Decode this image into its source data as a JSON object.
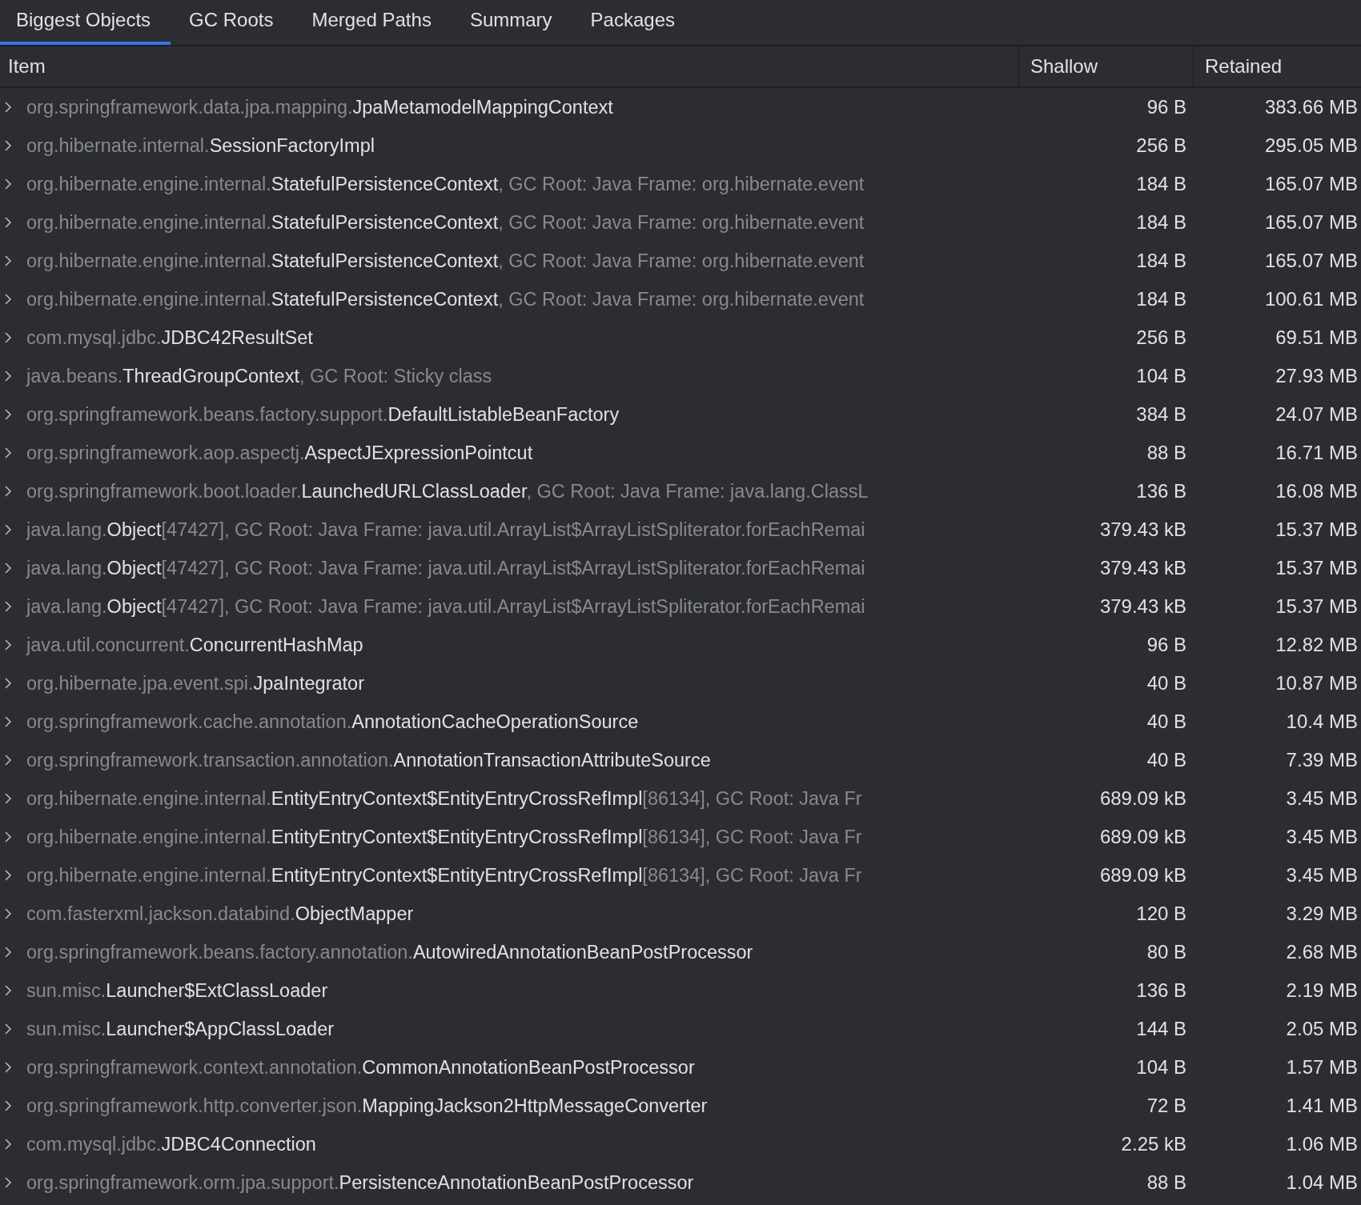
{
  "tabs": [
    {
      "label": "Biggest Objects",
      "selected": true
    },
    {
      "label": "GC Roots",
      "selected": false
    },
    {
      "label": "Merged Paths",
      "selected": false
    },
    {
      "label": "Summary",
      "selected": false
    },
    {
      "label": "Packages",
      "selected": false
    }
  ],
  "table": {
    "columns": [
      "Item",
      "Shallow",
      "Retained"
    ],
    "rows": [
      {
        "expanded": false,
        "package": "org.springframework.data.jpa.mapping.",
        "class": "JpaMetamodelMappingContext",
        "shallow": "96 B",
        "retained": "383.66 MB"
      },
      {
        "expanded": false,
        "package": "org.hibernate.internal.",
        "class": "SessionFactoryImpl",
        "shallow": "256 B",
        "retained": "295.05 MB"
      },
      {
        "expanded": false,
        "package": "org.hibernate.engine.internal.",
        "class": "StatefulPersistenceContext",
        "suffix": ", GC Root: Java Frame: org.hibernate.event",
        "shallow": "184 B",
        "retained": "165.07 MB"
      },
      {
        "expanded": false,
        "package": "org.hibernate.engine.internal.",
        "class": "StatefulPersistenceContext",
        "suffix": ", GC Root: Java Frame: org.hibernate.event",
        "shallow": "184 B",
        "retained": "165.07 MB"
      },
      {
        "expanded": false,
        "package": "org.hibernate.engine.internal.",
        "class": "StatefulPersistenceContext",
        "suffix": ", GC Root: Java Frame: org.hibernate.event",
        "shallow": "184 B",
        "retained": "165.07 MB"
      },
      {
        "expanded": false,
        "package": "org.hibernate.engine.internal.",
        "class": "StatefulPersistenceContext",
        "suffix": ", GC Root: Java Frame: org.hibernate.event",
        "shallow": "184 B",
        "retained": "100.61 MB"
      },
      {
        "expanded": false,
        "package": "com.mysql.jdbc.",
        "class": "JDBC42ResultSet",
        "shallow": "256 B",
        "retained": "69.51 MB"
      },
      {
        "expanded": false,
        "package": "java.beans.",
        "class": "ThreadGroupContext",
        "suffix": ", GC Root: Sticky class",
        "shallow": "104 B",
        "retained": "27.93 MB"
      },
      {
        "expanded": false,
        "package": "org.springframework.beans.factory.support.",
        "class": "DefaultListableBeanFactory",
        "shallow": "384 B",
        "retained": "24.07 MB"
      },
      {
        "expanded": false,
        "package": "org.springframework.aop.aspectj.",
        "class": "AspectJExpressionPointcut",
        "shallow": "88 B",
        "retained": "16.71 MB"
      },
      {
        "expanded": false,
        "package": "org.springframework.boot.loader.",
        "class": "LaunchedURLClassLoader",
        "suffix": ", GC Root: Java Frame: java.lang.ClassL",
        "shallow": "136 B",
        "retained": "16.08 MB"
      },
      {
        "expanded": false,
        "package": "java.lang.",
        "class": "Object",
        "suffix": "[47427], GC Root: Java Frame: java.util.ArrayList$ArrayListSpliterator.forEachRemai",
        "shallow": "379.43 kB",
        "retained": "15.37 MB"
      },
      {
        "expanded": false,
        "package": "java.lang.",
        "class": "Object",
        "suffix": "[47427], GC Root: Java Frame: java.util.ArrayList$ArrayListSpliterator.forEachRemai",
        "shallow": "379.43 kB",
        "retained": "15.37 MB"
      },
      {
        "expanded": false,
        "package": "java.lang.",
        "class": "Object",
        "suffix": "[47427], GC Root: Java Frame: java.util.ArrayList$ArrayListSpliterator.forEachRemai",
        "shallow": "379.43 kB",
        "retained": "15.37 MB"
      },
      {
        "expanded": false,
        "package": "java.util.concurrent.",
        "class": "ConcurrentHashMap",
        "shallow": "96 B",
        "retained": "12.82 MB"
      },
      {
        "expanded": false,
        "package": "org.hibernate.jpa.event.spi.",
        "class": "JpaIntegrator",
        "shallow": "40 B",
        "retained": "10.87 MB"
      },
      {
        "expanded": false,
        "package": "org.springframework.cache.annotation.",
        "class": "AnnotationCacheOperationSource",
        "shallow": "40 B",
        "retained": "10.4 MB"
      },
      {
        "expanded": false,
        "package": "org.springframework.transaction.annotation.",
        "class": "AnnotationTransactionAttributeSource",
        "shallow": "40 B",
        "retained": "7.39 MB"
      },
      {
        "expanded": false,
        "package": "org.hibernate.engine.internal.",
        "class": "EntityEntryContext$EntityEntryCrossRefImpl",
        "suffix": "[86134], GC Root: Java Fr",
        "shallow": "689.09 kB",
        "retained": "3.45 MB"
      },
      {
        "expanded": false,
        "package": "org.hibernate.engine.internal.",
        "class": "EntityEntryContext$EntityEntryCrossRefImpl",
        "suffix": "[86134], GC Root: Java Fr",
        "shallow": "689.09 kB",
        "retained": "3.45 MB"
      },
      {
        "expanded": false,
        "package": "org.hibernate.engine.internal.",
        "class": "EntityEntryContext$EntityEntryCrossRefImpl",
        "suffix": "[86134], GC Root: Java Fr",
        "shallow": "689.09 kB",
        "retained": "3.45 MB"
      },
      {
        "expanded": false,
        "package": "com.fasterxml.jackson.databind.",
        "class": "ObjectMapper",
        "shallow": "120 B",
        "retained": "3.29 MB"
      },
      {
        "expanded": false,
        "package": "org.springframework.beans.factory.annotation.",
        "class": "AutowiredAnnotationBeanPostProcessor",
        "shallow": "80 B",
        "retained": "2.68 MB"
      },
      {
        "expanded": false,
        "package": "sun.misc.",
        "class": "Launcher$ExtClassLoader",
        "shallow": "136 B",
        "retained": "2.19 MB"
      },
      {
        "expanded": false,
        "package": "sun.misc.",
        "class": "Launcher$AppClassLoader",
        "shallow": "144 B",
        "retained": "2.05 MB"
      },
      {
        "expanded": false,
        "package": "org.springframework.context.annotation.",
        "class": "CommonAnnotationBeanPostProcessor",
        "shallow": "104 B",
        "retained": "1.57 MB"
      },
      {
        "expanded": false,
        "package": "org.springframework.http.converter.json.",
        "class": "MappingJackson2HttpMessageConverter",
        "shallow": "72 B",
        "retained": "1.41 MB"
      },
      {
        "expanded": false,
        "package": "com.mysql.jdbc.",
        "class": "JDBC4Connection",
        "shallow": "2.25 kB",
        "retained": "1.06 MB"
      },
      {
        "expanded": false,
        "package": "org.springframework.orm.jpa.support.",
        "class": "PersistenceAnnotationBeanPostProcessor",
        "shallow": "88 B",
        "retained": "1.04 MB"
      }
    ]
  }
}
